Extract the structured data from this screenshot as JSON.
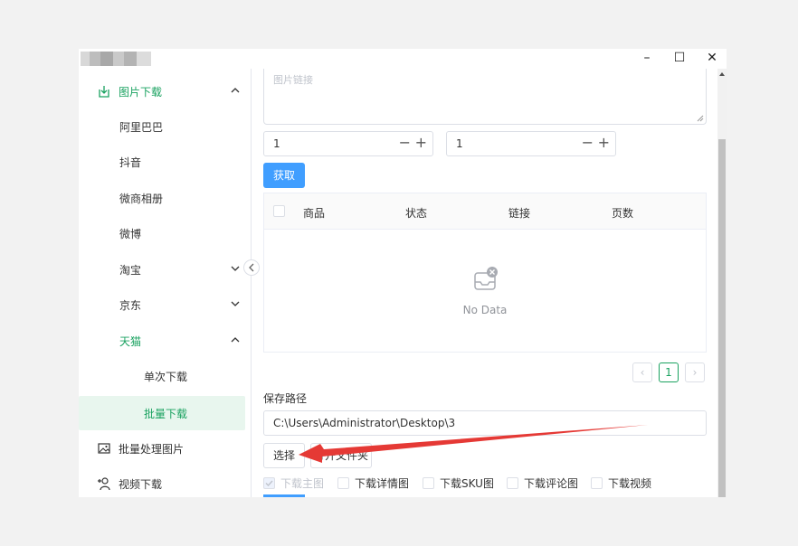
{
  "window": {
    "controls": {
      "minimize": "–",
      "maximize": "☐",
      "close": "✕"
    }
  },
  "sidebar": {
    "items": [
      {
        "label": "图片下载",
        "icon": "download-icon"
      },
      {
        "label": "阿里巴巴"
      },
      {
        "label": "抖音"
      },
      {
        "label": "微商相册"
      },
      {
        "label": "微博"
      },
      {
        "label": "淘宝"
      },
      {
        "label": "京东"
      },
      {
        "label": "天猫"
      },
      {
        "label": "单次下载"
      },
      {
        "label": "批量下载"
      },
      {
        "label": "批量处理图片",
        "icon": "image-icon"
      },
      {
        "label": "视频下载",
        "icon": "user-add-icon"
      }
    ]
  },
  "main": {
    "textarea_placeholder": "图片链接",
    "stepper1_value": "1",
    "stepper2_value": "1",
    "fetch_label": "获取",
    "table": {
      "headers": [
        "商品",
        "状态",
        "链接",
        "页数"
      ],
      "empty_text": "No Data"
    },
    "pager": {
      "prev": "‹",
      "current": "1",
      "next": "›"
    },
    "save_path_label": "保存路径",
    "save_path_value": "C:\\Users\\Administrator\\Desktop\\3",
    "choose_label": "选择",
    "open_folder_label": "打开文件夹",
    "options": [
      "下载主图",
      "下载详情图",
      "下载SKU图",
      "下载评论图",
      "下载视频"
    ]
  },
  "colors": {
    "accent": "#1aa260",
    "primary": "#409eff",
    "annotation": "#e53935"
  }
}
